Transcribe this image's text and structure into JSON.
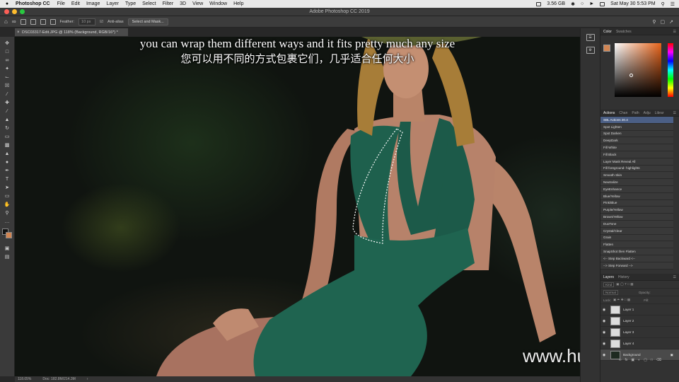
{
  "menubar": {
    "app": "Photoshop CC",
    "items": [
      "File",
      "Edit",
      "Image",
      "Layer",
      "Type",
      "Select",
      "Filter",
      "3D",
      "View",
      "Window",
      "Help"
    ],
    "memory": "3.56 GB",
    "datetime": "Sat May 30  5:53 PM"
  },
  "titlebar": {
    "title": "Adobe Photoshop CC 2019"
  },
  "options": {
    "feather_label": "Feather:",
    "feather_value": "10 px",
    "antialias_label": "Anti-alias",
    "select_mask": "Select and Mask..."
  },
  "document": {
    "tab": "DSC03317-Edit.JPG @ 118% (Background, RGB/16*) *"
  },
  "status": {
    "zoom": "118.05%",
    "doc": "Doc: 182.8M/214.3M"
  },
  "subtitles": {
    "en": "you can wrap them different ways and it fits pretty much any size",
    "zh": "您可以用不同的方式包裹它们，几乎适合任何大小"
  },
  "watermark": "www.hunts.com",
  "color_panel": {
    "tabs": [
      "Color",
      "Swatches"
    ],
    "fg": "#d28552",
    "bg": "#111111"
  },
  "actions_panel": {
    "tabs": [
      "Actions",
      "Chan",
      "Path",
      "Adju",
      "Librar"
    ],
    "items": [
      "SBL Actions 20.4",
      "Spot Lighten",
      "Spot Darken",
      "DeepDark",
      "Fill White",
      "Fill Black",
      "Layer Mask Reveal All",
      "Fill foreground- highlights",
      "Smooth Skin",
      "Neutralize",
      "EyeEnhance",
      "Blue/Yellow",
      "Pink/Blue",
      "Purple/Yellow",
      "Brown/Yellow",
      "DuoTone",
      "Crystal/Clear",
      "Grain",
      "Flatten",
      "SnapShot then Flatten",
      "<-- Step Backward  <--",
      "--> Step Forward  -->"
    ]
  },
  "layers_panel": {
    "tabs": [
      "Layers",
      "History"
    ],
    "kind": "Kind",
    "blend": "Normal",
    "opacity_label": "Opacity:",
    "lock_label": "Lock:",
    "fill_label": "Fill:",
    "layers": [
      "Layer 1",
      "Layer 2",
      "Layer 3",
      "Layer 4",
      "Background"
    ]
  }
}
